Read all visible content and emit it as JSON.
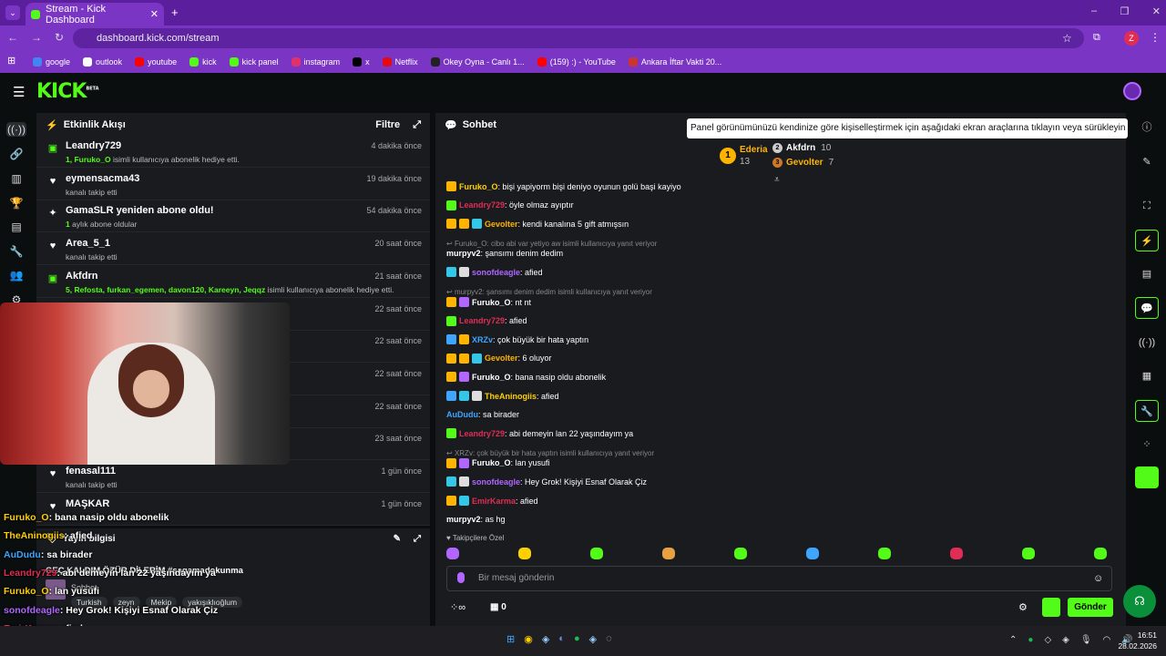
{
  "browser": {
    "tab_title": "Stream - Kick Dashboard",
    "url": "dashboard.kick.com/stream",
    "profile": "Z",
    "bookmarks": [
      {
        "label": "google",
        "color": "#4285f4"
      },
      {
        "label": "outlook",
        "color": "#ffffff"
      },
      {
        "label": "youtube",
        "color": "#ff0000"
      },
      {
        "label": "kick",
        "color": "#53fc18"
      },
      {
        "label": "kick panel",
        "color": "#53fc18"
      },
      {
        "label": "instagram",
        "color": "#e1306c"
      },
      {
        "label": "x",
        "color": "#000000"
      },
      {
        "label": "Netflix",
        "color": "#e50914"
      },
      {
        "label": "Okey Oyna - Canlı 1...",
        "color": "#222222"
      },
      {
        "label": "(159) :) - YouTube",
        "color": "#ff0000"
      },
      {
        "label": "Ankara İftar Vakti 20...",
        "color": "#cc3333"
      }
    ]
  },
  "header": {
    "logo": "KICK",
    "beta": "BETA"
  },
  "activity": {
    "title": "Etkinlik Akışı",
    "filter": "Filtre",
    "items": [
      {
        "icon": "gift-icon",
        "name": "Leandry729",
        "time": "4 dakika önce",
        "pre": "1, Furuko_O",
        "sub": " isimli kullanıcıya abonelik hediye etti."
      },
      {
        "icon": "heart-icon",
        "name": "eymensacma43",
        "time": "19 dakika önce",
        "pre": "",
        "sub": "kanalı takip etti"
      },
      {
        "icon": "star-icon",
        "name": "GamaSLR yeniden abone oldu!",
        "time": "54 dakika önce",
        "pre": "1",
        "sub": " aylık abone oldular"
      },
      {
        "icon": "heart-icon",
        "name": "Area_5_1",
        "time": "20 saat önce",
        "pre": "",
        "sub": "kanalı takip etti"
      },
      {
        "icon": "gift-icon",
        "name": "Akfdrn",
        "time": "21 saat önce",
        "pre": "5, Refosta, furkan_egemen, davon120, Kareeyn, Jeqqz",
        "sub": " isimli kullanıcıya abonelik hediye etti."
      },
      {
        "icon": "heart-icon",
        "name": "",
        "time": "22 saat önce",
        "pre": "",
        "sub": ""
      },
      {
        "icon": "heart-icon",
        "name": "",
        "time": "22 saat önce",
        "pre": "",
        "sub": ""
      },
      {
        "icon": "heart-icon",
        "name": "",
        "time": "22 saat önce",
        "pre": "",
        "sub": ""
      },
      {
        "icon": "heart-icon",
        "name": "",
        "time": "22 saat önce",
        "pre": "",
        "sub": ""
      },
      {
        "icon": "heart-icon",
        "name": "",
        "time": "23 saat önce",
        "pre": "",
        "sub": ""
      },
      {
        "icon": "heart-icon",
        "name": "fenasal111",
        "time": "1 gün önce",
        "pre": "",
        "sub": "kanalı takip etti"
      },
      {
        "icon": "heart-icon",
        "name": "MAŞKAR",
        "time": "1 gün önce",
        "pre": "",
        "sub": ""
      }
    ]
  },
  "stream_info": {
    "title": "Yayın bilgisi",
    "stream_title": "GEÇ KALDIM ÖZÜR DİLERİM #sagamadokunma",
    "category": "Sohbet",
    "tags": [
      "Turkish",
      "zeyn",
      "Mekip",
      "yakışıklıoğlum"
    ]
  },
  "overlay_chat": [
    {
      "user": "Furuko_O",
      "color": "#ffd000",
      "text": ": bana nasip oldu abonelik"
    },
    {
      "user": "TheAninogiis",
      "color": "#ffd000",
      "text": ": afied"
    },
    {
      "user": "AuDudu",
      "color": "#3ea6ff",
      "text": ": sa birader"
    },
    {
      "user": "Leandry729",
      "color": "#e02d55",
      "text": ": abi demeyin lan 22 yaşındayım ya"
    },
    {
      "user": "Furuko_O",
      "color": "#ffd000",
      "text": ": lan yusufi"
    },
    {
      "user": "sonofdeagle",
      "color": "#b066ff",
      "text": ": Hey Grok! Kişiyi Esnaf Olarak Çiz"
    },
    {
      "user": "EmirKarma",
      "color": "#e02d55",
      "text": ": afied"
    },
    {
      "user": "murpyv2",
      "color": "#ffffff",
      "text": ": as hg"
    }
  ],
  "chat": {
    "title": "Sohbet",
    "tooltip": "Panel görünümünüzü kendinize göre kişiselleştirmek için aşağıdaki ekran araçlarına tıklayın veya sürükleyin",
    "top_gifters": [
      {
        "rank": "1",
        "name": "Ederia",
        "count": "13"
      },
      {
        "rank": "2",
        "name": "Akfdrn",
        "count": "10"
      },
      {
        "rank": "3",
        "name": "Gevolter",
        "count": "7"
      }
    ],
    "messages": [
      {
        "type": "msg",
        "user": "Furuko_O",
        "color": "#ffd000",
        "text": ": bişi yapiyorm bişi deniyo oyunun golü başi kayiyo",
        "badges": [
          "#ffb400"
        ]
      },
      {
        "type": "msg",
        "user": "Leandry729",
        "color": "#e02d55",
        "text": ": öyle olmaz ayıptır",
        "badges": [
          "#53fc18"
        ]
      },
      {
        "type": "msg",
        "user": "Gevolter",
        "color": "#ffb400",
        "text": ": kendi kanalına 5 gift atmışsın",
        "badges": [
          "#ffb400",
          "#ffb400",
          "#34c8e8"
        ]
      },
      {
        "type": "reply",
        "text": "Furuko_O: cibo abi var yetiyo aw isimli kullanıcıya yanıt veriyor"
      },
      {
        "type": "msg",
        "user": "murpyv2",
        "color": "#ffffff",
        "text": ": şansımı denim dedim",
        "badges": []
      },
      {
        "type": "msg",
        "user": "sonofdeagle",
        "color": "#b066ff",
        "text": ": afied",
        "badges": [
          "#34c8e8",
          "#dddddd"
        ]
      },
      {
        "type": "reply",
        "text": "murpyv2: şansımı denim dedim isimli kullanıcıya yanıt veriyor"
      },
      {
        "type": "msg",
        "user": "Furuko_O",
        "color": "#ffffff",
        "text": ": nt nt",
        "badges": [
          "#ffb400",
          "#b066ff"
        ]
      },
      {
        "type": "msg",
        "user": "Leandry729",
        "color": "#e02d55",
        "text": ": afied",
        "badges": [
          "#53fc18"
        ]
      },
      {
        "type": "msg",
        "user": "XRZv",
        "color": "#3ea6ff",
        "text": ": çok büyük bir hata yaptın",
        "badges": [
          "#3ea6ff",
          "#ffb400"
        ]
      },
      {
        "type": "msg",
        "user": "Gevolter",
        "color": "#ffb400",
        "text": ": 6 oluyor",
        "badges": [
          "#ffb400",
          "#ffb400",
          "#34c8e8"
        ]
      },
      {
        "type": "msg",
        "user": "Furuko_O",
        "color": "#ffffff",
        "text": ": bana nasip oldu abonelik",
        "badges": [
          "#ffb400",
          "#b066ff"
        ]
      },
      {
        "type": "msg",
        "user": "TheAninogiis",
        "color": "#ffd000",
        "text": ": afied",
        "badges": [
          "#3ea6ff",
          "#34c8e8",
          "#dddddd"
        ]
      },
      {
        "type": "msg",
        "user": "AuDudu",
        "color": "#3ea6ff",
        "text": ": sa birader",
        "badges": []
      },
      {
        "type": "msg",
        "user": "Leandry729",
        "color": "#e02d55",
        "text": ": abi demeyin lan 22 yaşındayım ya",
        "badges": [
          "#53fc18"
        ]
      },
      {
        "type": "reply",
        "text": "XRZv: çok büyük bir hata yaptın isimli kullanıcıya yanıt veriyor"
      },
      {
        "type": "msg",
        "user": "Furuko_O",
        "color": "#ffffff",
        "text": ": lan yusufi",
        "badges": [
          "#ffb400",
          "#b066ff"
        ]
      },
      {
        "type": "msg",
        "user": "sonofdeagle",
        "color": "#b066ff",
        "text": ": Hey Grok! Kişiyi Esnaf Olarak Çiz",
        "badges": [
          "#34c8e8",
          "#dddddd"
        ]
      },
      {
        "type": "msg",
        "user": "EmirKarma",
        "color": "#e02d55",
        "text": ": afied",
        "badges": [
          "#ffb400",
          "#34c8e8"
        ]
      },
      {
        "type": "msg",
        "user": "murpyv2",
        "color": "#ffffff",
        "text": ": as hg",
        "badges": []
      }
    ],
    "followers_only": "Takipçilere Özel",
    "emotes": [
      "#b066ff",
      "#ffd000",
      "#53fc18",
      "#e8a040",
      "#53fc18",
      "#3ea6ff",
      "#53fc18",
      "#e02d55",
      "#53fc18",
      "#53fc18"
    ],
    "placeholder": "Bir mesaj gönderin",
    "count": "0",
    "send": "Gönder"
  },
  "taskbar": {
    "time": "16:51",
    "date": "28.02.2026"
  },
  "colors": {
    "accent": "#53fc18",
    "panel": "#191b1f",
    "bg": "#0b0e0f",
    "browser": "#7a35c4"
  }
}
